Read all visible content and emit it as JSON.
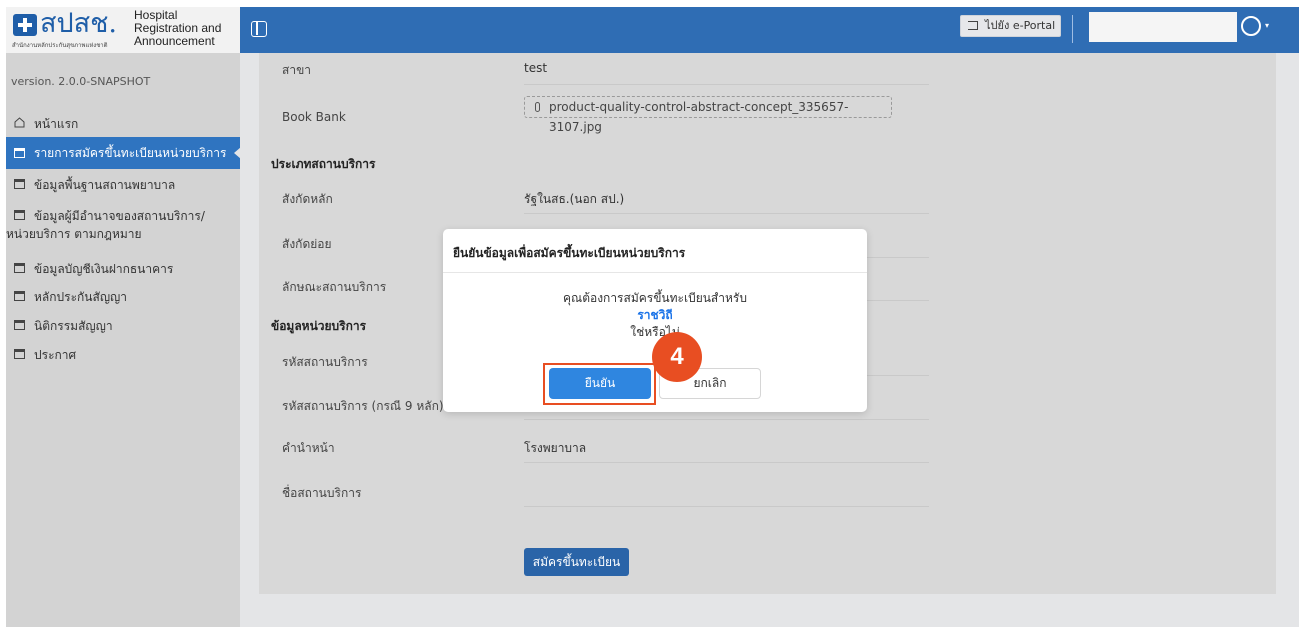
{
  "sidebar": {
    "logo_text": "สปสช.",
    "logo_subtitle": "สำนักงานหลักประกันสุขภาพแห่งชาติ",
    "app_title_lines": [
      "Hospital",
      "Registration and",
      "Announcement"
    ],
    "version": "version. 2.0.0-SNAPSHOT",
    "items": [
      {
        "label": "หน้าแรก"
      },
      {
        "label": "รายการสมัครขึ้นทะเบียนหน่วยบริการ",
        "active": true
      },
      {
        "label": "ข้อมูลพื้นฐานสถานพยาบาล"
      },
      {
        "label": "ข้อมูลผู้มีอำนาจของสถานบริการ/",
        "label2": "หน่วยบริการ ตามกฎหมาย"
      },
      {
        "label": "ข้อมูลบัญชีเงินฝากธนาคาร"
      },
      {
        "label": "หลักประกันสัญญา"
      },
      {
        "label": "นิติกรรมสัญญา"
      },
      {
        "label": "ประกาศ"
      }
    ]
  },
  "header": {
    "eportal_label": "ไปยัง e-Portal"
  },
  "form": {
    "branch_label": "สาขา",
    "branch_value": "test",
    "bookbank_label": "Book Bank",
    "bookbank_file": "product-quality-control-abstract-concept_335657-3107.jpg",
    "section_service_type": "ประเภทสถานบริการ",
    "main_affiliation_label": "สังกัดหลัก",
    "main_affiliation_value": "รัฐในสธ.(นอก สป.)",
    "sub_affiliation_label": "สังกัดย่อย",
    "service_nature_label": "ลักษณะสถานบริการ",
    "section_unit_info": "ข้อมูลหน่วยบริการ",
    "service_code_label": "รหัสสถานบริการ",
    "service_code9_label": "รหัสสถานบริการ (กรณี 9 หลัก)",
    "prefix_label": "คำนำหน้า",
    "prefix_value": "โรงพยาบาล",
    "service_name_label": "ชื่อสถานบริการ",
    "submit_label": "สมัครขึ้นทะเบียน"
  },
  "modal": {
    "title": "ยืนยันข้อมูลเพื่อสมัครขึ้นทะเบียนหน่วยบริการ",
    "question": "คุณต้องการสมัครขึ้นทะเบียนสำหรับ",
    "unit_name": "ราชวิถี",
    "confirm_question": "ใช่หรือไม่",
    "confirm_label": "ยืนยัน",
    "cancel_label": "ยกเลิก",
    "step_number": "4"
  },
  "colors": {
    "header": "#2f6db4",
    "active_nav": "#2f74c0",
    "confirm": "#2f86e0",
    "highlight": "#e84e22"
  }
}
